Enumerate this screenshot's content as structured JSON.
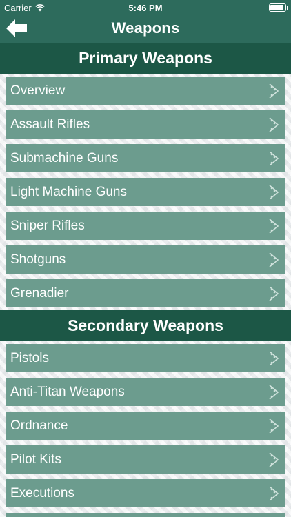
{
  "status_bar": {
    "carrier": "Carrier",
    "time": "5:46 PM"
  },
  "nav": {
    "title": "Weapons",
    "back_icon": "arrow-left-icon"
  },
  "sections": [
    {
      "title": "Primary Weapons",
      "items": [
        {
          "label": "Overview"
        },
        {
          "label": "Assault Rifles"
        },
        {
          "label": "Submachine Guns"
        },
        {
          "label": "Light Machine Guns"
        },
        {
          "label": "Sniper Rifles"
        },
        {
          "label": "Shotguns"
        },
        {
          "label": "Grenadier"
        }
      ]
    },
    {
      "title": "Secondary Weapons",
      "items": [
        {
          "label": "Pistols"
        },
        {
          "label": "Anti-Titan Weapons"
        },
        {
          "label": "Ordnance"
        },
        {
          "label": "Pilot Kits"
        },
        {
          "label": "Executions"
        }
      ]
    }
  ],
  "colors": {
    "nav_background": "#2d6b5c",
    "section_header": "#1c5746",
    "row_background": "#6c9c8e",
    "text": "#ffffff"
  }
}
